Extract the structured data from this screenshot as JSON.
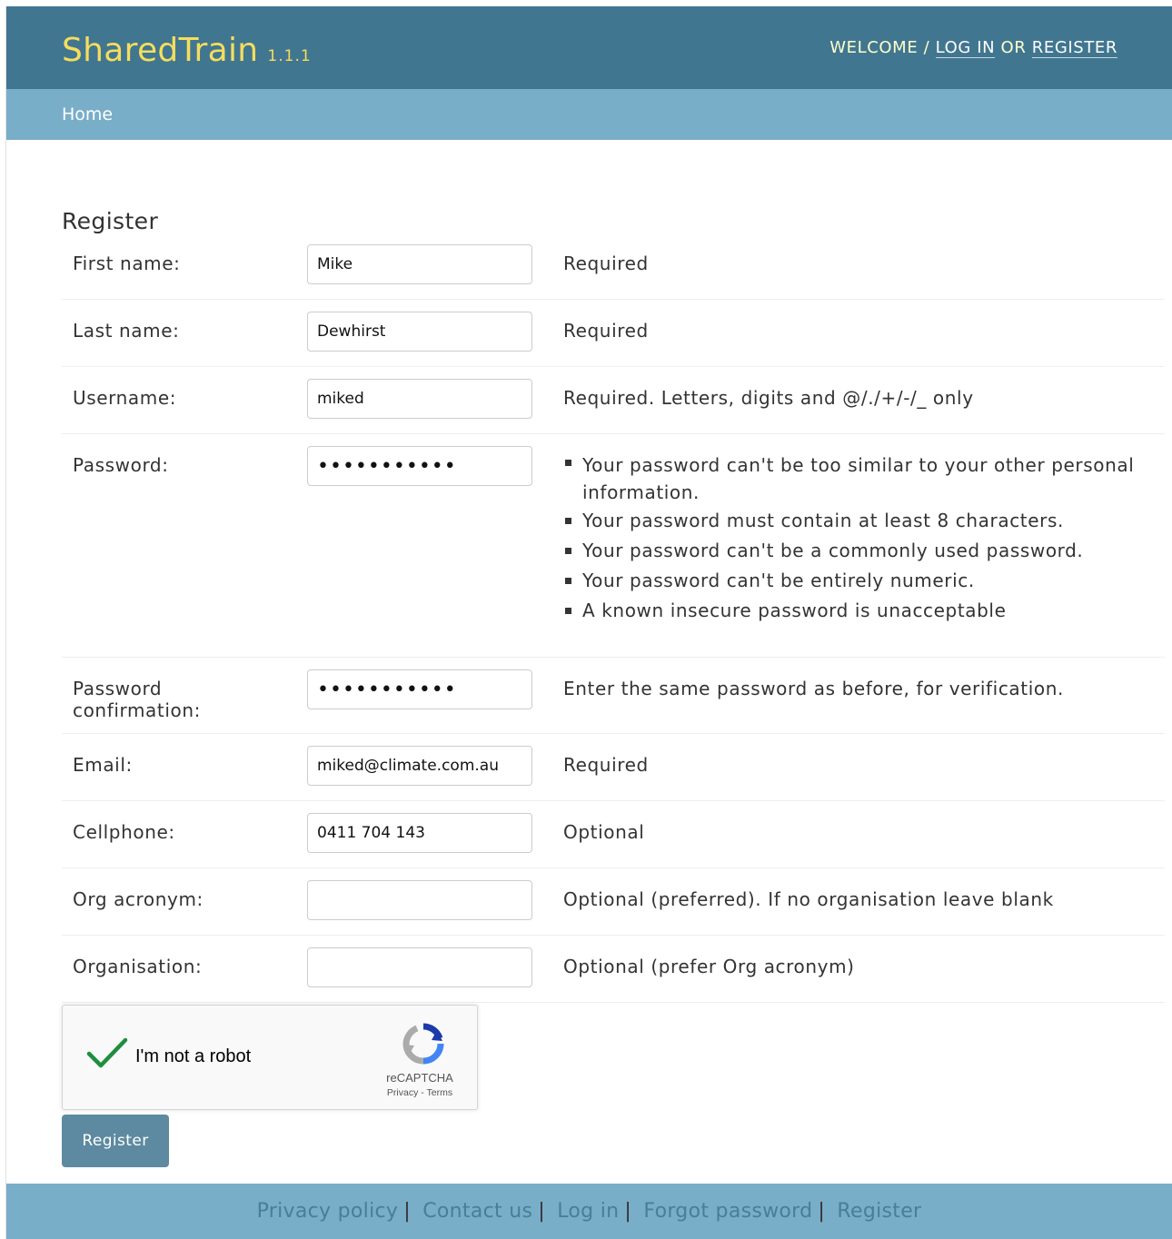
{
  "header": {
    "brand": "SharedTrain",
    "version": "1.1.1",
    "welcome": "WELCOME /",
    "log_in": "LOG IN",
    "or": "OR",
    "register": "REGISTER"
  },
  "breadcrumbs": {
    "home": "Home"
  },
  "page_title": "Register",
  "form": {
    "first_name": {
      "label": "First name:",
      "value": "Mike",
      "help": "Required"
    },
    "last_name": {
      "label": "Last name:",
      "value": "Dewhirst",
      "help": "Required"
    },
    "username": {
      "label": "Username:",
      "value": "miked",
      "help": "Required. Letters, digits and @/./+/-/_ only"
    },
    "password": {
      "label": "Password:",
      "value": "•••••••••••",
      "help_items": [
        "Your password can't be too similar to your other personal information.",
        "Your password must contain at least 8 characters.",
        "Your password can't be a commonly used password.",
        "Your password can't be entirely numeric.",
        "A known insecure password is unacceptable"
      ]
    },
    "password_confirmation": {
      "label": "Password confirmation:",
      "value": "•••••••••••",
      "help": "Enter the same password as before, for verification."
    },
    "email": {
      "label": "Email:",
      "value": "miked@climate.com.au",
      "help": "Required"
    },
    "cellphone": {
      "label": "Cellphone:",
      "value": "0411 704 143",
      "help": "Optional"
    },
    "org_acronym": {
      "label": "Org acronym:",
      "value": "",
      "help": "Optional (preferred). If no organisation leave blank"
    },
    "organisation": {
      "label": "Organisation:",
      "value": "",
      "help": "Optional (prefer Org acronym)"
    }
  },
  "recaptcha": {
    "label": "I'm not a robot",
    "brand": "reCAPTCHA",
    "privacy_terms": "Privacy - Terms",
    "checked": true,
    "check_color": "#1e8e3e",
    "logo_icon": "recaptcha-logo-icon"
  },
  "submit": {
    "label": "Register"
  },
  "footer": {
    "links": [
      "Privacy policy",
      "Contact us",
      "Log in",
      "Forgot password",
      "Register"
    ]
  },
  "colors": {
    "header_bg": "#417690",
    "breadcrumb_bg": "#79aec8",
    "brand": "#f5dd5d"
  }
}
